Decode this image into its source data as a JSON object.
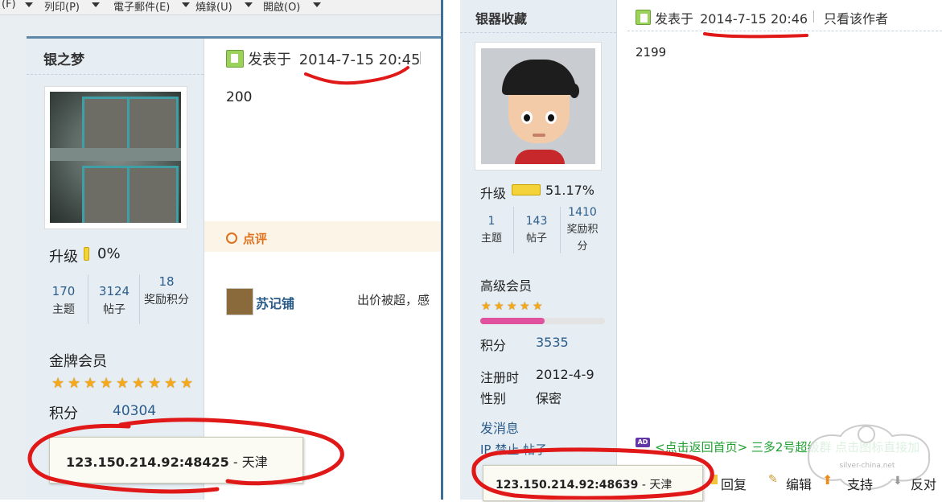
{
  "left_window": {
    "menu": [
      "(F)",
      "列印(P)",
      "電子郵件(E)",
      "燒錄(U)",
      "開啟(O)"
    ],
    "user": {
      "name": "银之梦",
      "upgrade_label": "升级",
      "upgrade_percent": "0%",
      "stats": [
        {
          "value": "170",
          "label": "主题"
        },
        {
          "value": "3124",
          "label": "帖子"
        },
        {
          "value": "18",
          "label": "奖励积分"
        }
      ],
      "level": "金牌会员",
      "stars": 9,
      "points_label": "积分",
      "points_value": "40304"
    },
    "post": {
      "posted_prefix": "发表于",
      "datetime": "2014-7-15 20:45",
      "body": "200",
      "review_label": "点评",
      "review_user": "苏记铺",
      "review_text": "出价被超，感"
    },
    "ip_popup": {
      "ip": "123.150.214.92:48425",
      "location": "- 天津"
    }
  },
  "right_window": {
    "user": {
      "name": "银器收藏",
      "upgrade_label": "升级",
      "upgrade_percent": "51.17%",
      "upgrade_fraction": 0.5117,
      "stats": [
        {
          "value": "1",
          "label": "主题"
        },
        {
          "value": "143",
          "label": "帖子"
        },
        {
          "value": "1410",
          "label": "奖励积分"
        }
      ],
      "level": "高级会员",
      "stars": 5,
      "points_label": "积分",
      "points_value": "3535",
      "register_label": "注册时",
      "register_value": "2012-4-9",
      "gender_label": "性别",
      "gender_value": "保密",
      "send_message": "发消息",
      "ip_ban_label": "IP 禁止 帖子"
    },
    "post": {
      "posted_prefix": "发表于",
      "datetime": "2014-7-15 20:46",
      "only_author": "只看该作者",
      "body": "2199",
      "ad_badge": "AD",
      "ad_text": "<点击返回首页> 三多2号超级群 点击图标直接加"
    },
    "actions": {
      "reply": "回复",
      "edit": "编辑",
      "support": "支持",
      "oppose": "反对"
    },
    "ip_popup": {
      "ip": "123.150.214.92:48639",
      "location": "- 天津"
    },
    "watermark": "silver-china.net"
  },
  "colors": {
    "annotation_red": "#e01818",
    "link_blue": "#2b5c8a",
    "accent_orange": "#e0701b",
    "header_blue": "#5d86a7"
  }
}
